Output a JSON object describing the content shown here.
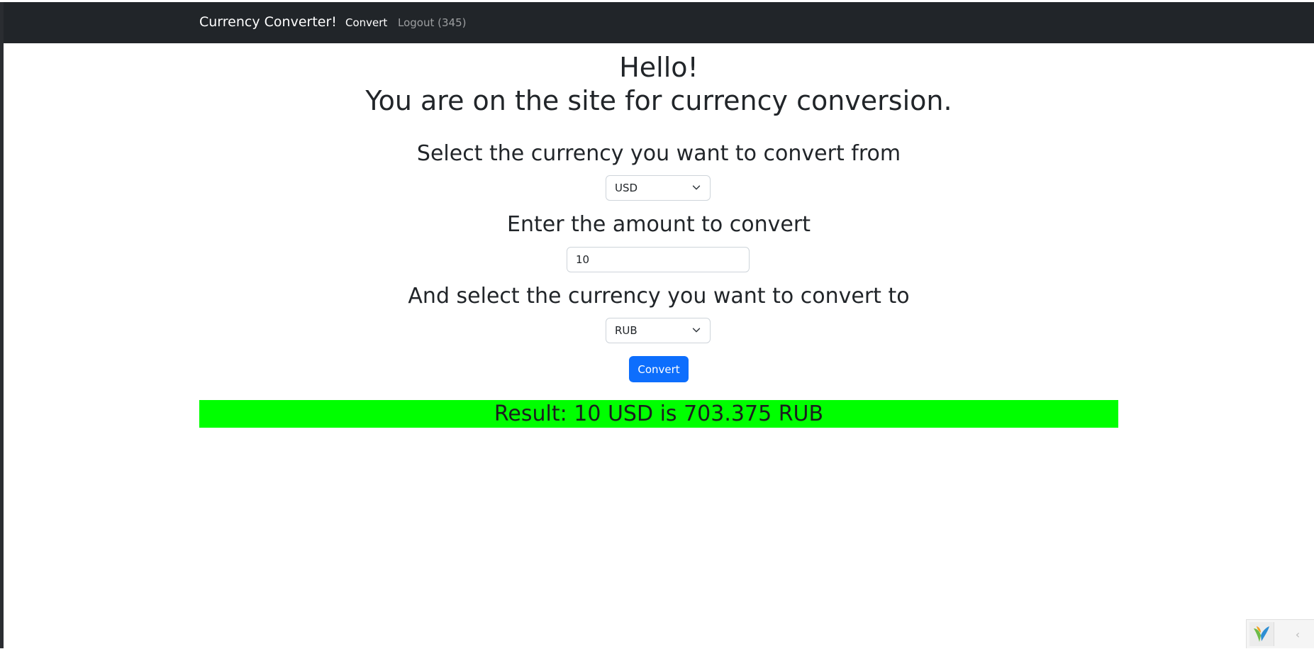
{
  "navbar": {
    "brand": "Currency Converter!",
    "links": [
      {
        "label": "Convert",
        "active": true
      },
      {
        "label": "Logout (345)",
        "active": false
      }
    ]
  },
  "main": {
    "greeting": "Hello!",
    "subtitle": "You are on the site for currency conversion.",
    "from_label": "Select the currency you want to convert from",
    "from_currency": "USD",
    "amount_label": "Enter the amount to convert",
    "amount_value": "10",
    "to_label": "And select the currency you want to convert to",
    "to_currency": "RUB",
    "convert_button": "Convert",
    "result": "Result: 10 USD is 703.375 RUB"
  },
  "colors": {
    "navbar_bg": "#212529",
    "primary": "#0d6efd",
    "result_bg": "#00ff00"
  },
  "icons": {
    "select_arrow": "chevron-down-icon",
    "debug_logo": "yii-logo-icon",
    "debug_toggle": "chevron-left-icon"
  }
}
